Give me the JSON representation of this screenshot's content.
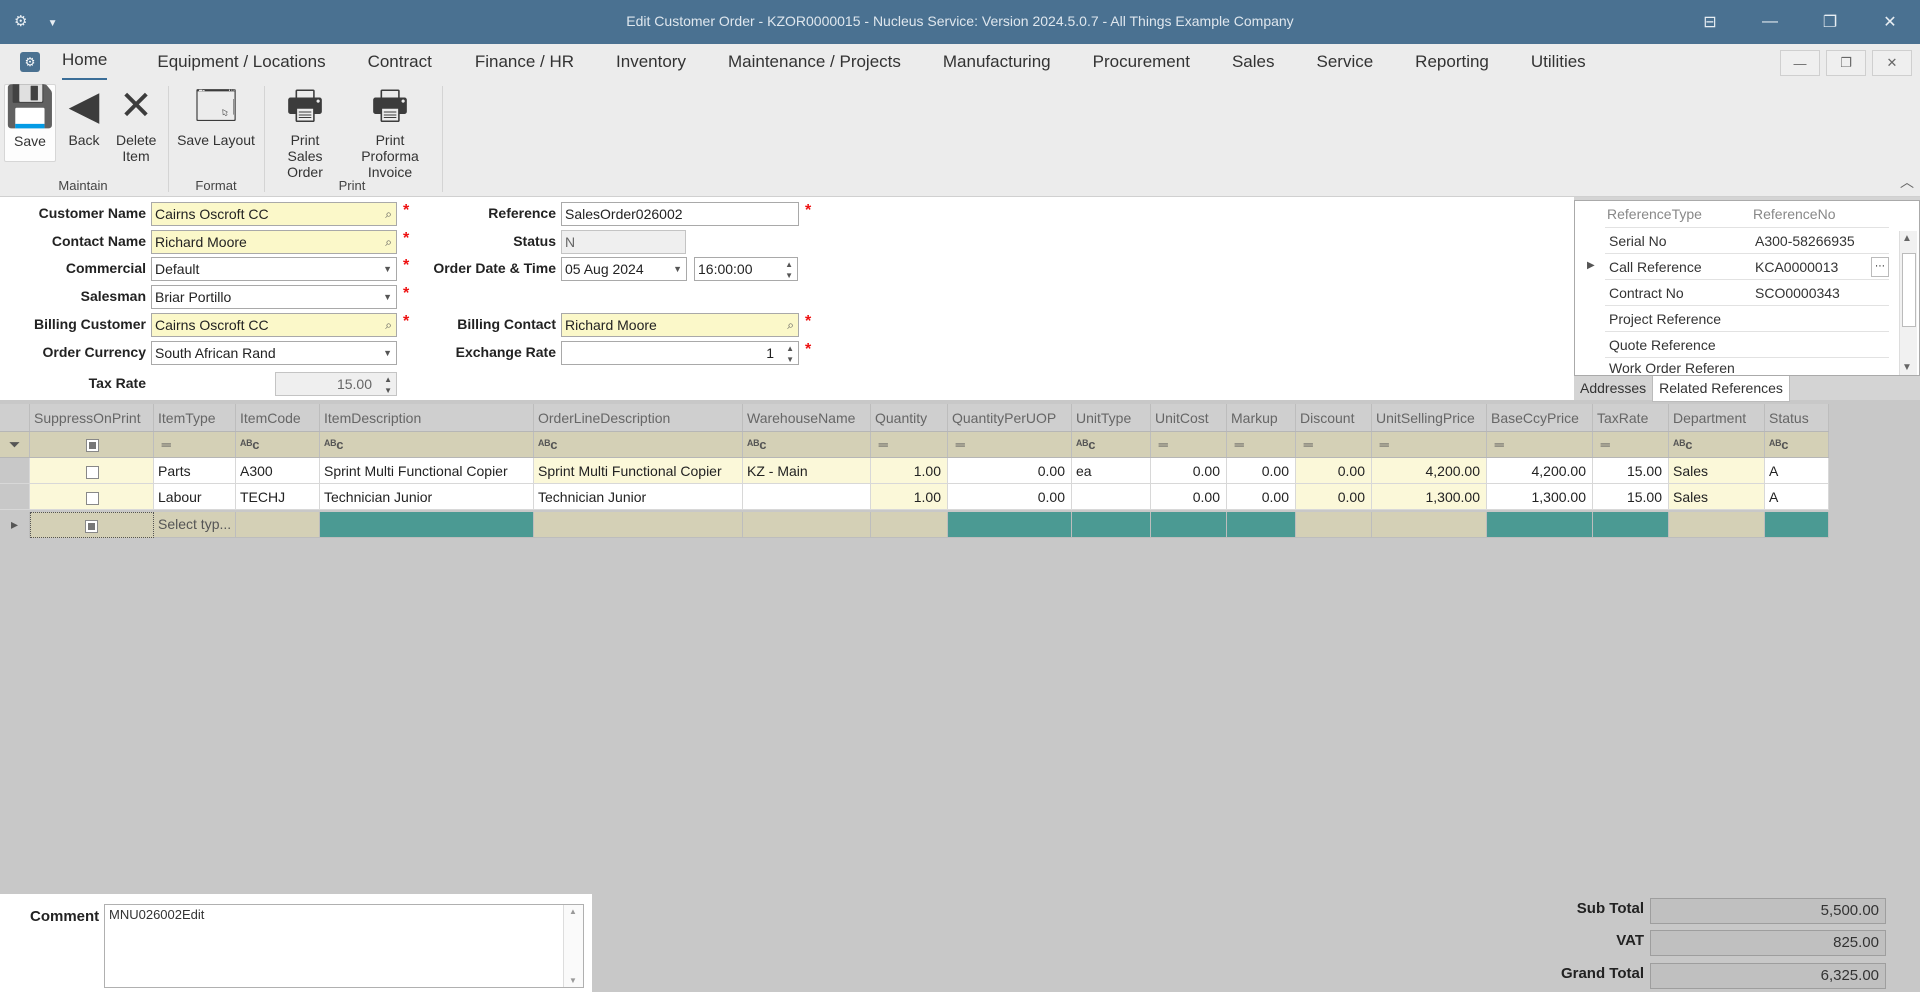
{
  "window": {
    "title": "Edit Customer Order - KZOR0000015 - Nucleus Service: Version 2024.5.0.7 - All Things Example Company"
  },
  "menu": {
    "items": [
      "Home",
      "Equipment / Locations",
      "Contract",
      "Finance / HR",
      "Inventory",
      "Maintenance / Projects",
      "Manufacturing",
      "Procurement",
      "Sales",
      "Service",
      "Reporting",
      "Utilities"
    ]
  },
  "ribbon": {
    "save": "Save",
    "back": "Back",
    "delete_item": "Delete Item",
    "save_layout": "Save Layout",
    "print_sales_order": "Print Sales Order",
    "print_proforma": "Print Proforma Invoice",
    "groups": {
      "maintain": "Maintain",
      "format": "Format",
      "print": "Print"
    }
  },
  "form": {
    "customer_name_label": "Customer Name",
    "customer_name": "Cairns Oscroft CC",
    "contact_name_label": "Contact Name",
    "contact_name": "Richard Moore",
    "commercial_label": "Commercial",
    "commercial": "Default",
    "salesman_label": "Salesman",
    "salesman": "Briar Portillo",
    "billing_customer_label": "Billing Customer",
    "billing_customer": "Cairns Oscroft CC",
    "order_currency_label": "Order Currency",
    "order_currency": "South African Rand",
    "tax_rate_label": "Tax Rate",
    "tax_rate": "15.00",
    "reference_label": "Reference",
    "reference": "SalesOrder026002",
    "status_label": "Status",
    "status": "N",
    "order_date_label": "Order Date & Time",
    "order_date": "05 Aug 2024",
    "order_time": "16:00:00",
    "billing_contact_label": "Billing Contact",
    "billing_contact": "Richard Moore",
    "exchange_rate_label": "Exchange Rate",
    "exchange_rate": "1"
  },
  "references": {
    "headers": {
      "type": "ReferenceType",
      "no": "ReferenceNo"
    },
    "rows": [
      {
        "type": "Serial No",
        "no": "A300-58266935"
      },
      {
        "type": "Call Reference",
        "no": "KCA0000013"
      },
      {
        "type": "Contract No",
        "no": "SCO0000343"
      },
      {
        "type": "Project Reference",
        "no": ""
      },
      {
        "type": "Quote Reference",
        "no": ""
      },
      {
        "type": "Work Order Referen",
        "no": ""
      }
    ],
    "tabs": [
      "Addresses",
      "Related References"
    ]
  },
  "grid": {
    "columns": [
      "SuppressOnPrint",
      "ItemType",
      "ItemCode",
      "ItemDescription",
      "OrderLineDescription",
      "WarehouseName",
      "Quantity",
      "QuantityPerUOP",
      "UnitType",
      "UnitCost",
      "Markup",
      "Discount",
      "UnitSellingPrice",
      "BaseCcyPrice",
      "TaxRate",
      "Department",
      "Status"
    ],
    "rows": [
      {
        "item_type": "Parts",
        "item_code": "A300",
        "item_desc": "Sprint Multi Functional Copier",
        "line_desc": "Sprint Multi Functional Copier",
        "warehouse": "KZ - Main",
        "qty": "1.00",
        "qty_uop": "0.00",
        "unit_type": "ea",
        "unit_cost": "0.00",
        "markup": "0.00",
        "discount": "0.00",
        "selling": "4,200.00",
        "base": "4,200.00",
        "tax": "15.00",
        "dept": "Sales",
        "status": "A"
      },
      {
        "item_type": "Labour",
        "item_code": "TECHJ",
        "item_desc": "Technician Junior",
        "line_desc": "Technician Junior",
        "warehouse": "",
        "qty": "1.00",
        "qty_uop": "0.00",
        "unit_type": "",
        "unit_cost": "0.00",
        "markup": "0.00",
        "discount": "0.00",
        "selling": "1,300.00",
        "base": "1,300.00",
        "tax": "15.00",
        "dept": "Sales",
        "status": "A"
      }
    ],
    "new_row_placeholder": "Select typ..."
  },
  "footer": {
    "comment_label": "Comment",
    "comment": "MNU026002Edit",
    "sub_total_label": "Sub Total",
    "sub_total": "5,500.00",
    "vat_label": "VAT",
    "vat": "825.00",
    "grand_total_label": "Grand Total",
    "grand_total": "6,325.00"
  }
}
